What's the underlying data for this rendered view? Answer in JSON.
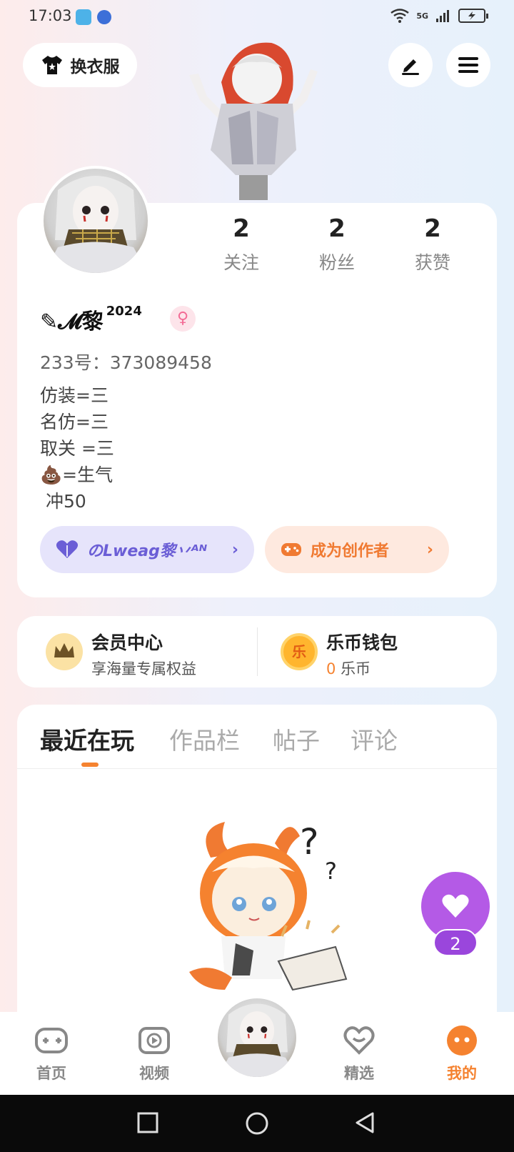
{
  "status_bar": {
    "time": "17:03",
    "network": "5G"
  },
  "header": {
    "outfit_label": "换衣服"
  },
  "profile": {
    "stats": [
      {
        "value": "2",
        "label": "关注"
      },
      {
        "value": "2",
        "label": "粉丝"
      },
      {
        "value": "2",
        "label": "获赞"
      }
    ],
    "nickname": "✎𝓜黎",
    "nickname_sup": "2024",
    "gender_symbol": "♀",
    "uid": "233号：373089458",
    "bio": [
      "仿装=三",
      "名仿=三",
      "取关 =三",
      "💩=生气",
      " 冲50"
    ],
    "fan_badge": "のLweag黎丷ᴬᴺ",
    "creator_label": "成为创作者"
  },
  "wallet": {
    "member_title": "会员中心",
    "member_sub": "享海量专属权益",
    "coin_title": "乐币钱包",
    "coin_amount": "0",
    "coin_unit": "乐币",
    "coin_icon_text": "乐"
  },
  "tabs": [
    "最近在玩",
    "作品栏",
    "帖子",
    "评论"
  ],
  "like_count": "2",
  "bottom_nav": {
    "home": "首页",
    "video": "视频",
    "featured": "精选",
    "mine": "我的"
  },
  "colors": {
    "accent": "#f5822f",
    "purple": "#b45ae6",
    "fan": "#6b5ed6"
  }
}
